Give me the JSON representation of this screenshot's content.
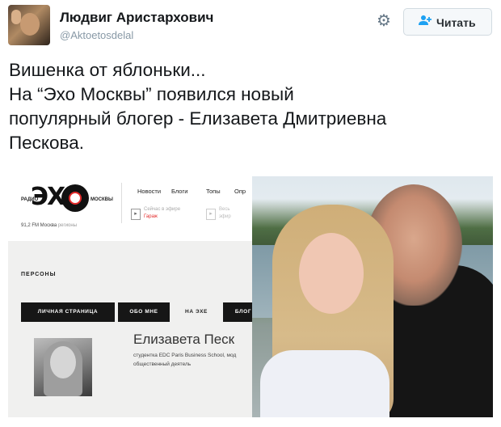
{
  "tweet": {
    "author_name": "Людвиг Аристархович",
    "handle": "@Aktoetosdelal",
    "follow_label": "Читать",
    "text_lines": [
      "Вишенка от яблоньки...",
      "На “Эхо Москвы” появился новый",
      "популярный блогер - Елизавета Дмитриевна",
      "Пескова."
    ]
  },
  "icons": {
    "settings": "gear-icon",
    "follow": "add-user-icon",
    "play": "play-icon"
  },
  "colors": {
    "accent": "#1da1f2",
    "echo_red": "#e32b2b",
    "tab_dark": "#161616"
  },
  "embedded_site": {
    "logo": {
      "radio": "РАДИО",
      "brand": "ЭХО",
      "city": "МОСКВЫ"
    },
    "frequency": "91,2 FM Москва",
    "regions": "регионы",
    "nav": [
      "Новости",
      "Блоги",
      "Топы",
      "Опр"
    ],
    "now_playing": {
      "label": "Сейчас в эфире",
      "show": "Гараж"
    },
    "next_playing": {
      "label": "Весь",
      "show": "эфир"
    },
    "section_title": "ПЕРСОНЫ",
    "tabs": [
      "ЛИЧНАЯ СТРАНИЦА",
      "ОБО МНЕ",
      "НА ЭХЕ",
      "БЛОГ"
    ],
    "active_tab_index": 2,
    "person_name": "Елизавета Песк",
    "person_description": "студентка EDC Paris Business School, мод общественный деятель"
  }
}
